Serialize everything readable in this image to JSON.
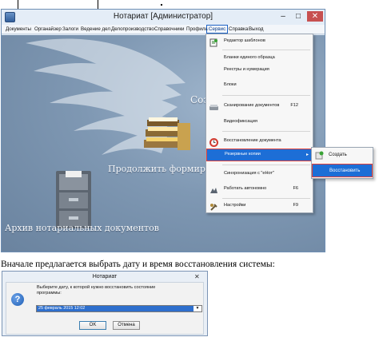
{
  "window": {
    "title": "Нотариат [Администратор]",
    "controls": {
      "minimize": "–",
      "maximize": "□",
      "close": "✕"
    }
  },
  "menubar": {
    "items": [
      "Документы",
      "Органайзер",
      "Залоги",
      "Ведение дел",
      "Делопроизводство",
      "Справочники",
      "Профиль",
      "Сервис",
      "Справка",
      "Выход"
    ],
    "active_index": 7
  },
  "background": {
    "zakazat_text": "Созд",
    "prodolzhit_text": "Продолжить формирова",
    "arhiv_text": "Архив нотариальных документов"
  },
  "service_menu": {
    "items": [
      {
        "label": "Редактор шаблонов",
        "shortcut": "",
        "icon": "template-editor-icon"
      },
      {
        "label": "Бланки единого образца",
        "shortcut": "",
        "icon": ""
      },
      {
        "label": "Реестры и нумерация",
        "shortcut": "",
        "icon": ""
      },
      {
        "label": "Блоки",
        "shortcut": "",
        "icon": ""
      },
      {
        "label": "Сканирование документов",
        "shortcut": "F12",
        "icon": "scanner-icon"
      },
      {
        "label": "Видеофиксация",
        "shortcut": "",
        "icon": ""
      },
      {
        "label": "Восстановление документа",
        "shortcut": "",
        "icon": "restore-document-icon"
      },
      {
        "label": "Резервные копии",
        "shortcut": "",
        "icon": ""
      },
      {
        "label": "Синхронизация с \"eНот\"",
        "shortcut": "",
        "icon": ""
      },
      {
        "label": "Работать автономно",
        "shortcut": "F6",
        "icon": "offline-icon"
      },
      {
        "label": "Настройки",
        "shortcut": "F9",
        "icon": "settings-icon"
      }
    ],
    "highlighted_index": 7,
    "submenu_arrow": "▸"
  },
  "backup_submenu": {
    "items": [
      "Создать",
      "Восстановить"
    ],
    "highlighted_index": 1
  },
  "caption": "Вначале предлагается выбрать дату и время восстановления системы:",
  "dialog": {
    "title": "Нотариат",
    "close": "✕",
    "icon_glyph": "?",
    "message": "Выберите дату, к которой нужно восстановить состояние программы:",
    "selected_value": "25 февраль 2015 12:02",
    "caret": "▼",
    "ok_label": "OK",
    "cancel_label": "Отмена"
  },
  "colors": {
    "highlight": "#1d6ed6",
    "red_frame": "#e2423c",
    "titlebar": "#e4edf7"
  }
}
